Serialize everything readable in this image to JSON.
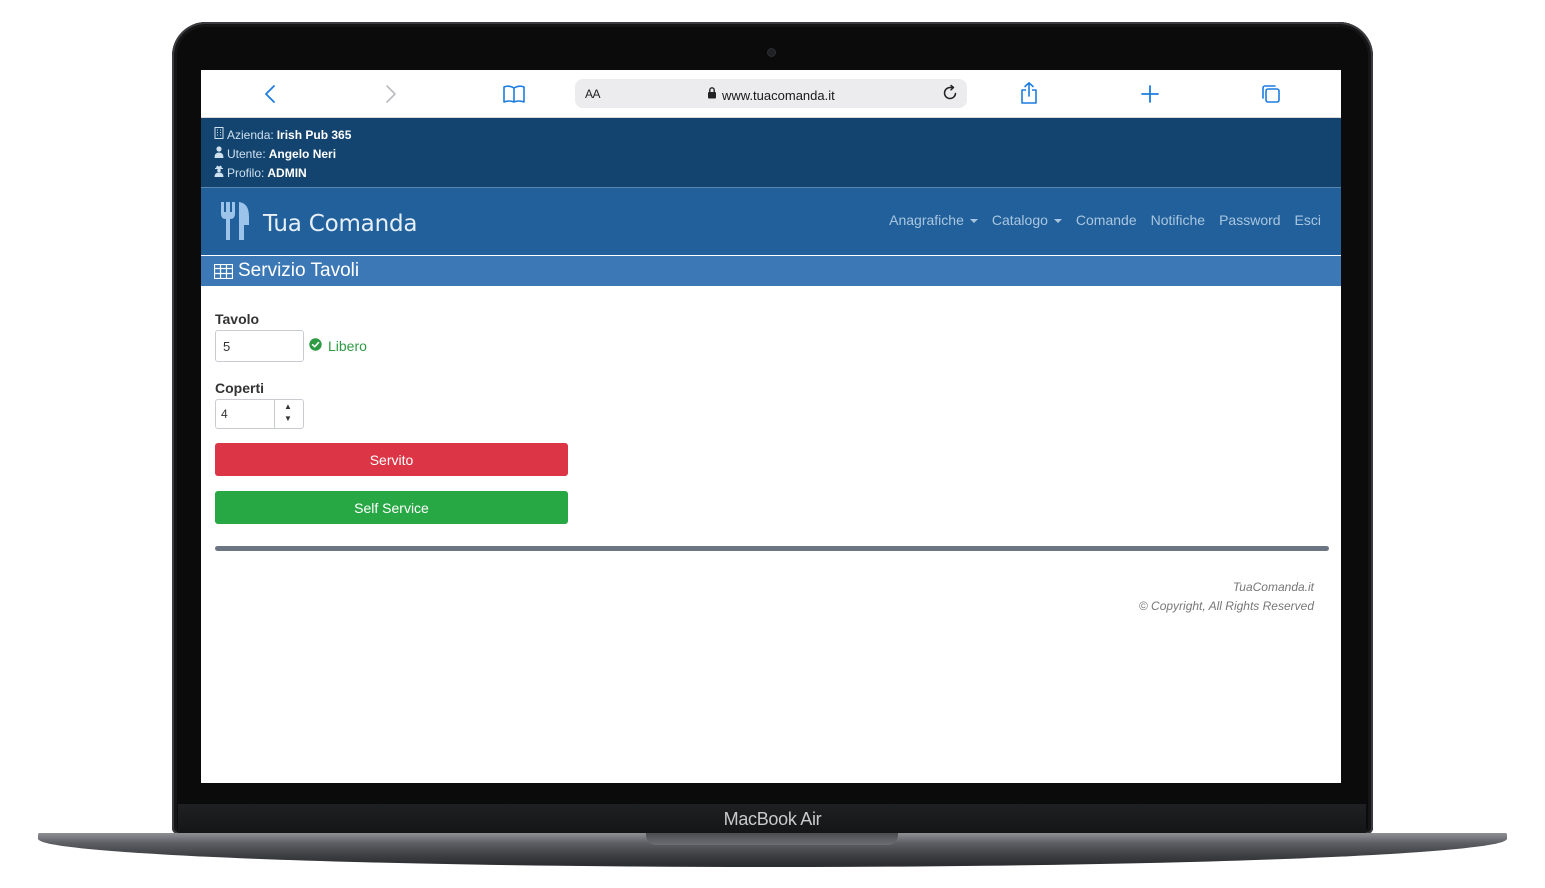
{
  "device": {
    "label": "MacBook Air"
  },
  "browser": {
    "text_size_label": "AA",
    "url": "www.tuacomanda.it",
    "icons": [
      "back-icon",
      "forward-icon",
      "bookmarks-icon",
      "lock-icon",
      "reload-icon",
      "share-icon",
      "new-tab-icon",
      "tabs-icon"
    ]
  },
  "info": {
    "azienda_label": "Azienda:",
    "azienda_value": "Irish Pub 365",
    "utente_label": "Utente:",
    "utente_value": "Angelo Neri",
    "profilo_label": "Profilo:",
    "profilo_value": "ADMIN"
  },
  "navbar": {
    "brand": "Tua Comanda",
    "items": [
      {
        "label": "Anagrafiche",
        "dropdown": true
      },
      {
        "label": "Catalogo",
        "dropdown": true
      },
      {
        "label": "Comande",
        "dropdown": false
      },
      {
        "label": "Notifiche",
        "dropdown": false
      },
      {
        "label": "Password",
        "dropdown": false
      },
      {
        "label": "Esci",
        "dropdown": false
      }
    ]
  },
  "page": {
    "title": "Servizio Tavoli"
  },
  "form": {
    "tavolo_label": "Tavolo",
    "tavolo_value": "5",
    "status_text": "Libero",
    "coperti_label": "Coperti",
    "coperti_value": "4",
    "servito_label": "Servito",
    "self_service_label": "Self Service"
  },
  "footer": {
    "line1": "TuaComanda.it",
    "line2": "© Copyright, All Rights Reserved"
  },
  "colors": {
    "info_bg": "#12446f",
    "navbar_bg": "#21609b",
    "title_bg": "#3c78b6",
    "danger": "#dc3545",
    "success": "#28a745",
    "status": "#2e9a43"
  }
}
